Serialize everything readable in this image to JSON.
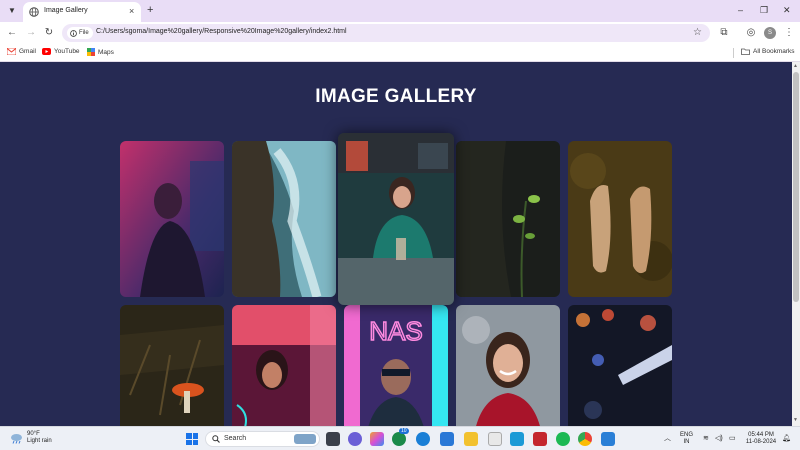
{
  "browser": {
    "tab_title": "Image Gallery",
    "tab_close": "×",
    "new_tab": "+",
    "minimize": "–",
    "maximize": "❐",
    "close": "✕",
    "chip_label": "File",
    "url": "C:/Users/sgoma/Image%20gallery/Responsive%20Image%20gallery/index2.html",
    "bookmarks": [
      "Gmail",
      "YouTube",
      "Maps"
    ],
    "all_bookmarks": "All Bookmarks",
    "profile_initial": "S"
  },
  "page": {
    "title": "IMAGE GALLERY",
    "background": "#262a53",
    "images": [
      {
        "row": 1,
        "col": 1,
        "subject": "woman-neon-pink-room"
      },
      {
        "row": 1,
        "col": 2,
        "subject": "cliff-ocean-waves"
      },
      {
        "row": 1,
        "col": 3,
        "subject": "woman-cafe-drink",
        "state": "hovered"
      },
      {
        "row": 1,
        "col": 4,
        "subject": "plant-sprout-dark"
      },
      {
        "row": 1,
        "col": 5,
        "subject": "shoes-on-ground"
      },
      {
        "row": 2,
        "col": 1,
        "subject": "red-mushroom-forest"
      },
      {
        "row": 2,
        "col": 2,
        "subject": "woman-neon-lights"
      },
      {
        "row": 2,
        "col": 3,
        "subject": "man-neon-sign"
      },
      {
        "row": 2,
        "col": 4,
        "subject": "smiling-woman-red-top"
      },
      {
        "row": 2,
        "col": 5,
        "subject": "bokeh-night-lights"
      }
    ]
  },
  "taskbar": {
    "temperature": "90°F",
    "weather": "Light rain",
    "search_placeholder": "Search",
    "language_top": "ENG",
    "language_bottom": "IN",
    "time": "05:44 PM",
    "date": "11-08-2024",
    "badge_count": "10"
  }
}
